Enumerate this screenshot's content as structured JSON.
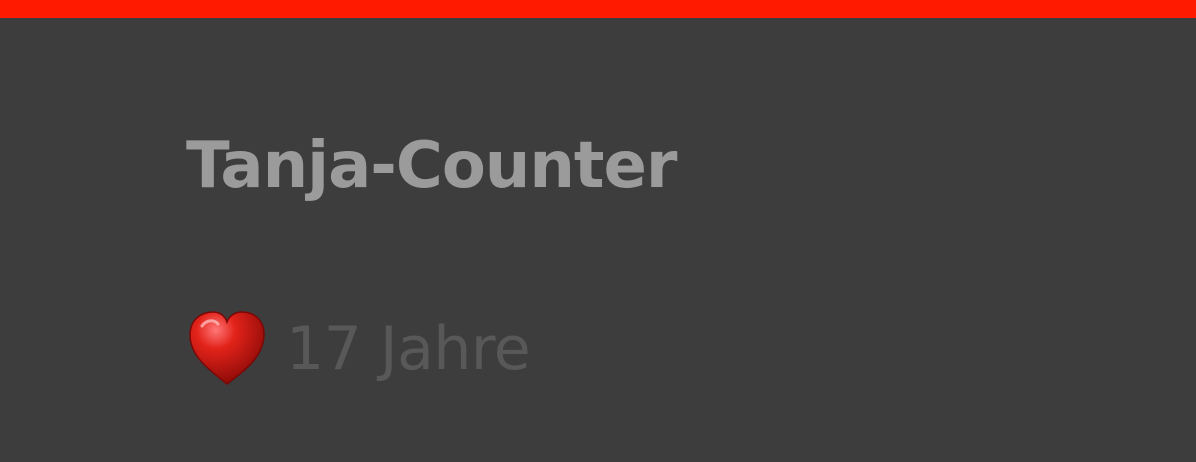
{
  "header": {
    "accent_color": "#ff1a00"
  },
  "widget": {
    "background": "#3d3d3d",
    "title": "Tanja-Counter",
    "title_color": "#9b9b9b",
    "counter": {
      "icon": "heart-icon",
      "text": "17 Jahre",
      "text_color": "#585858"
    }
  }
}
